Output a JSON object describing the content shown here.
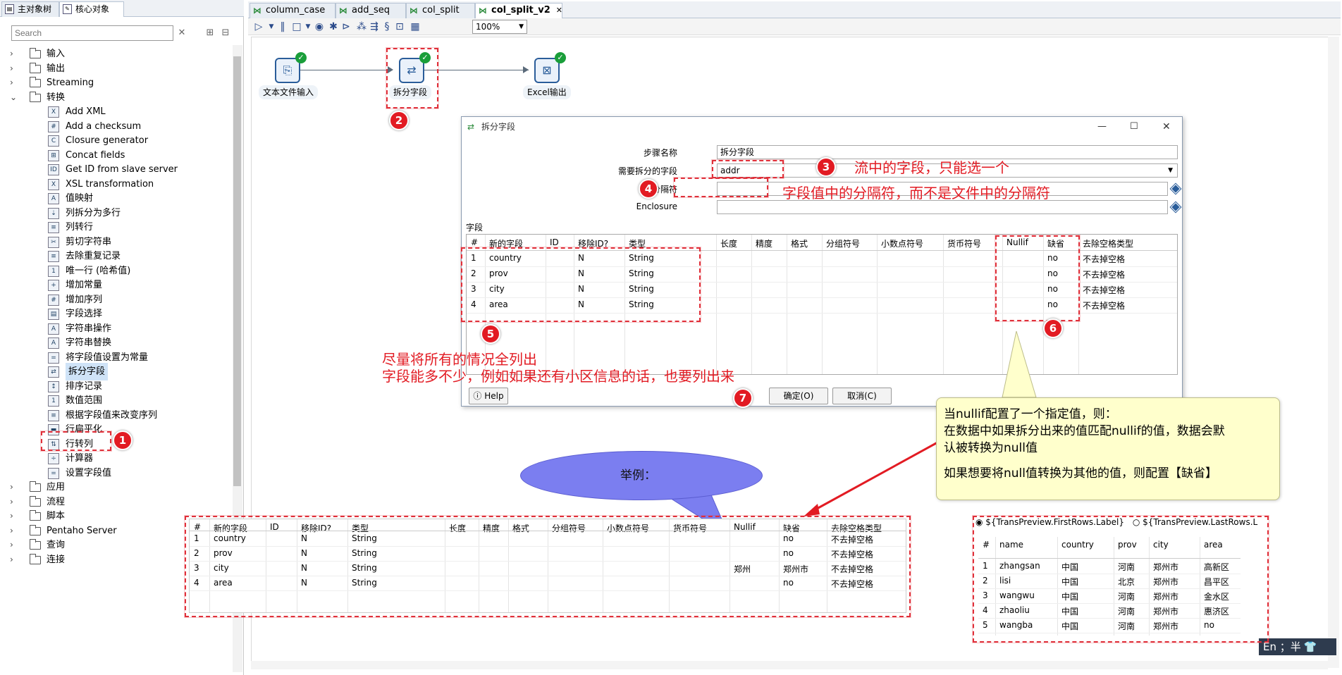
{
  "left_panel": {
    "tabs": [
      "主对象树",
      "核心对象"
    ],
    "search_placeholder": "Search",
    "tree": [
      {
        "type": "folder",
        "label": "输入",
        "expanded": false
      },
      {
        "type": "folder",
        "label": "输出",
        "expanded": false
      },
      {
        "type": "folder",
        "label": "Streaming",
        "expanded": false
      },
      {
        "type": "folder",
        "label": "转换",
        "expanded": true
      },
      {
        "type": "step",
        "label": "Add XML",
        "icon": "xml-icon"
      },
      {
        "type": "step",
        "label": "Add a checksum",
        "icon": "checksum-icon"
      },
      {
        "type": "step",
        "label": "Closure generator",
        "icon": "closure-icon"
      },
      {
        "type": "step",
        "label": "Concat fields",
        "icon": "concat-icon"
      },
      {
        "type": "step",
        "label": "Get ID from slave server",
        "icon": "id-icon"
      },
      {
        "type": "step",
        "label": "XSL transformation",
        "icon": "xsl-icon"
      },
      {
        "type": "step",
        "label": "值映射",
        "icon": "value-map-icon"
      },
      {
        "type": "step",
        "label": "列拆分为多行",
        "icon": "split-rows-icon"
      },
      {
        "type": "step",
        "label": "列转行",
        "icon": "col-to-row-icon"
      },
      {
        "type": "step",
        "label": "剪切字符串",
        "icon": "cut-string-icon"
      },
      {
        "type": "step",
        "label": "去除重复记录",
        "icon": "dedupe-icon"
      },
      {
        "type": "step",
        "label": "唯一行 (哈希值)",
        "icon": "unique-hash-icon"
      },
      {
        "type": "step",
        "label": "增加常量",
        "icon": "add-constant-icon"
      },
      {
        "type": "step",
        "label": "增加序列",
        "icon": "add-sequence-icon"
      },
      {
        "type": "step",
        "label": "字段选择",
        "icon": "select-fields-icon"
      },
      {
        "type": "step",
        "label": "字符串操作",
        "icon": "string-ops-icon"
      },
      {
        "type": "step",
        "label": "字符串替换",
        "icon": "string-replace-icon"
      },
      {
        "type": "step",
        "label": "将字段值设置为常量",
        "icon": "set-constant-icon"
      },
      {
        "type": "step",
        "label": "拆分字段",
        "icon": "split-field-icon",
        "selected": true
      },
      {
        "type": "step",
        "label": "排序记录",
        "icon": "sort-icon"
      },
      {
        "type": "step",
        "label": "数值范围",
        "icon": "number-range-icon"
      },
      {
        "type": "step",
        "label": "根据字段值来改变序列",
        "icon": "change-seq-icon"
      },
      {
        "type": "step",
        "label": "行扁平化",
        "icon": "flatten-icon"
      },
      {
        "type": "step",
        "label": "行转列",
        "icon": "row-to-col-icon"
      },
      {
        "type": "step",
        "label": "计算器",
        "icon": "calculator-icon"
      },
      {
        "type": "step",
        "label": "设置字段值",
        "icon": "set-value-icon"
      },
      {
        "type": "folder",
        "label": "应用",
        "expanded": false
      },
      {
        "type": "folder",
        "label": "流程",
        "expanded": false
      },
      {
        "type": "folder",
        "label": "脚本",
        "expanded": false
      },
      {
        "type": "folder",
        "label": "Pentaho Server",
        "expanded": false
      },
      {
        "type": "folder",
        "label": "查询",
        "expanded": false
      },
      {
        "type": "folder",
        "label": "连接",
        "expanded": false
      }
    ]
  },
  "editor_tabs": [
    {
      "label": "column_case",
      "active": false
    },
    {
      "label": "add_seq",
      "active": false
    },
    {
      "label": "col_split",
      "active": false
    },
    {
      "label": "col_split_v2",
      "active": true,
      "close": "✕"
    }
  ],
  "toolbar": {
    "zoom": "100%"
  },
  "canvas": {
    "steps": [
      {
        "label": "文本文件输入",
        "icon": "text-file-icon"
      },
      {
        "label": "拆分字段",
        "icon": "split-field-icon"
      },
      {
        "label": "Excel输出",
        "icon": "excel-icon"
      }
    ]
  },
  "dialog": {
    "title": "拆分字段",
    "step_name_label": "步骤名称",
    "step_name_value": "拆分字段",
    "split_field_label": "需要拆分的字段",
    "split_field_value": "addr",
    "delimiter_label": "分隔符",
    "delimiter_value": "",
    "enclosure_label": "Enclosure",
    "enclosure_value": "",
    "fields_label": "字段",
    "columns": [
      "#",
      "新的字段",
      "ID",
      "移除ID?",
      "类型",
      "长度",
      "精度",
      "格式",
      "分组符号",
      "小数点符号",
      "货币符号",
      "Nullif",
      "缺省",
      "去除空格类型"
    ],
    "rows": [
      [
        "1",
        "country",
        "",
        "N",
        "String",
        "",
        "",
        "",
        "",
        "",
        "",
        "",
        "no",
        "不去掉空格"
      ],
      [
        "2",
        "prov",
        "",
        "N",
        "String",
        "",
        "",
        "",
        "",
        "",
        "",
        "",
        "no",
        "不去掉空格"
      ],
      [
        "3",
        "city",
        "",
        "N",
        "String",
        "",
        "",
        "",
        "",
        "",
        "",
        "",
        "no",
        "不去掉空格"
      ],
      [
        "4",
        "area",
        "",
        "N",
        "String",
        "",
        "",
        "",
        "",
        "",
        "",
        "",
        "no",
        "不去掉空格"
      ]
    ],
    "help_label": "Help",
    "ok_label": "确定(O)",
    "cancel_label": "取消(C)"
  },
  "annotations": {
    "note3": "流中的字段，只能选一个",
    "note4": "字段值中的分隔符，而不是文件中的分隔符",
    "note5_line1": "尽量将所有的情况全列出",
    "note5_line2": "字段能多不少，例如如果还有小区信息的话，也要列出来",
    "callout_line1": "当nullif配置了一个指定值，则：",
    "callout_line2": "在数据中如果拆分出来的值匹配nullif的值，数据会默",
    "callout_line3": "认被转换为null值",
    "callout_line4": "如果想要将null值转换为其他的值，则配置【缺省】",
    "bubble": "举例：",
    "badges": [
      "1",
      "2",
      "3",
      "4",
      "5",
      "6",
      "7"
    ]
  },
  "example_grid": {
    "columns": [
      "#",
      "新的字段",
      "ID",
      "移除ID?",
      "类型",
      "长度",
      "精度",
      "格式",
      "分组符号",
      "小数点符号",
      "货币符号",
      "Nullif",
      "缺省",
      "去除空格类型"
    ],
    "rows": [
      [
        "1",
        "country",
        "",
        "N",
        "String",
        "",
        "",
        "",
        "",
        "",
        "",
        "",
        "no",
        "不去掉空格"
      ],
      [
        "2",
        "prov",
        "",
        "N",
        "String",
        "",
        "",
        "",
        "",
        "",
        "",
        "",
        "no",
        "不去掉空格"
      ],
      [
        "3",
        "city",
        "",
        "N",
        "String",
        "",
        "",
        "",
        "",
        "",
        "",
        "郑州",
        "郑州市",
        "不去掉空格"
      ],
      [
        "4",
        "area",
        "",
        "N",
        "String",
        "",
        "",
        "",
        "",
        "",
        "",
        "",
        "no",
        "不去掉空格"
      ]
    ]
  },
  "preview": {
    "radio_first": "${TransPreview.FirstRows.Label}",
    "radio_last": "${TransPreview.LastRows.L",
    "columns": [
      "#",
      "name",
      "country",
      "prov",
      "city",
      "area"
    ],
    "rows": [
      [
        "1",
        "zhangsan",
        "中国",
        "河南",
        "郑州市",
        "高新区"
      ],
      [
        "2",
        "lisi",
        "中国",
        "北京",
        "郑州市",
        "昌平区"
      ],
      [
        "3",
        "wangwu",
        "中国",
        "河南",
        "郑州市",
        "金水区"
      ],
      [
        "4",
        "zhaoliu",
        "中国",
        "河南",
        "郑州市",
        "惠济区"
      ],
      [
        "5",
        "wangba",
        "中国",
        "河南",
        "郑州市",
        "no"
      ]
    ]
  },
  "ime": {
    "text": "En ；半"
  }
}
